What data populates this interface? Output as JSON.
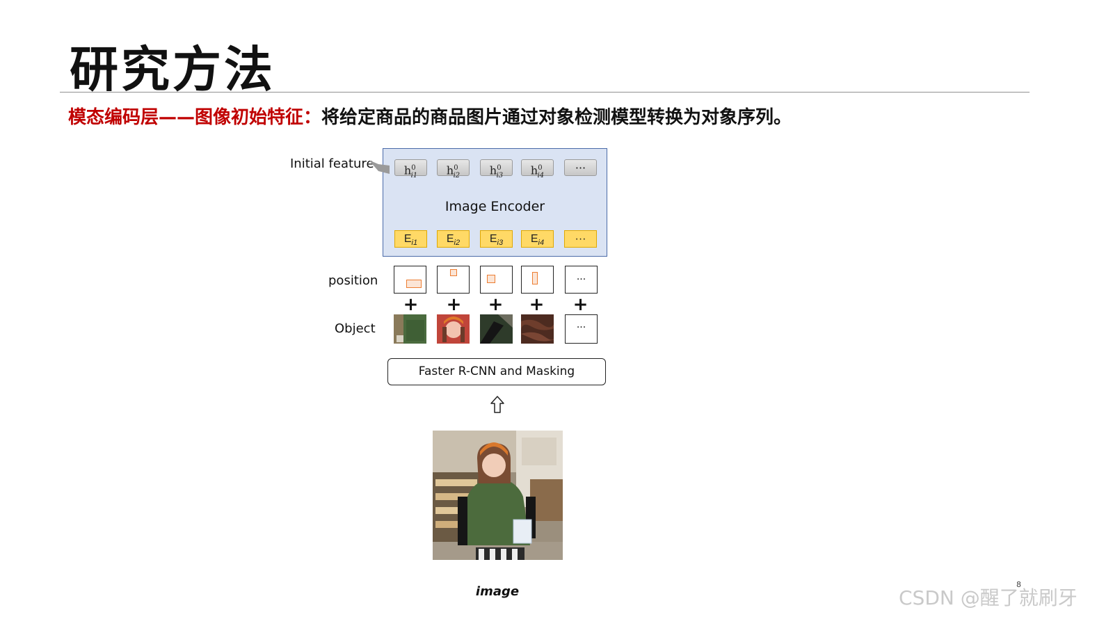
{
  "slide": {
    "title": "研究方法",
    "subtitle_red": "模态编码层——图像初始特征：",
    "subtitle_black": "将给定商品的商品图片通过对象检测模型转换为对象序列。",
    "page_number": "8"
  },
  "diagram": {
    "initial_label": "Initial feature",
    "encoder_label": "Image Encoder",
    "h_tokens": [
      {
        "base": "h",
        "sup": "0",
        "sub": "i1"
      },
      {
        "base": "h",
        "sup": "0",
        "sub": "i2"
      },
      {
        "base": "h",
        "sup": "0",
        "sub": "i3"
      },
      {
        "base": "h",
        "sup": "0",
        "sub": "i4"
      },
      {
        "base": "···",
        "sup": "",
        "sub": ""
      }
    ],
    "e_tokens": [
      {
        "base": "E",
        "sub": "i1"
      },
      {
        "base": "E",
        "sub": "i2"
      },
      {
        "base": "E",
        "sub": "i3"
      },
      {
        "base": "E",
        "sub": "i4"
      },
      {
        "base": "···",
        "sub": ""
      }
    ],
    "position_label": "position",
    "object_label": "Object",
    "ellipsis": "···",
    "plus": "+",
    "detector_label": "Faster R-CNN and Masking",
    "image_caption": "image"
  },
  "watermark": "CSDN @醒了就刷牙",
  "colors": {
    "title_red": "#c00000",
    "encoder_fill": "#dae3f3",
    "encoder_border": "#4a6aa8",
    "e_token_fill": "#ffd966",
    "position_box_stroke": "#ed7d31"
  }
}
